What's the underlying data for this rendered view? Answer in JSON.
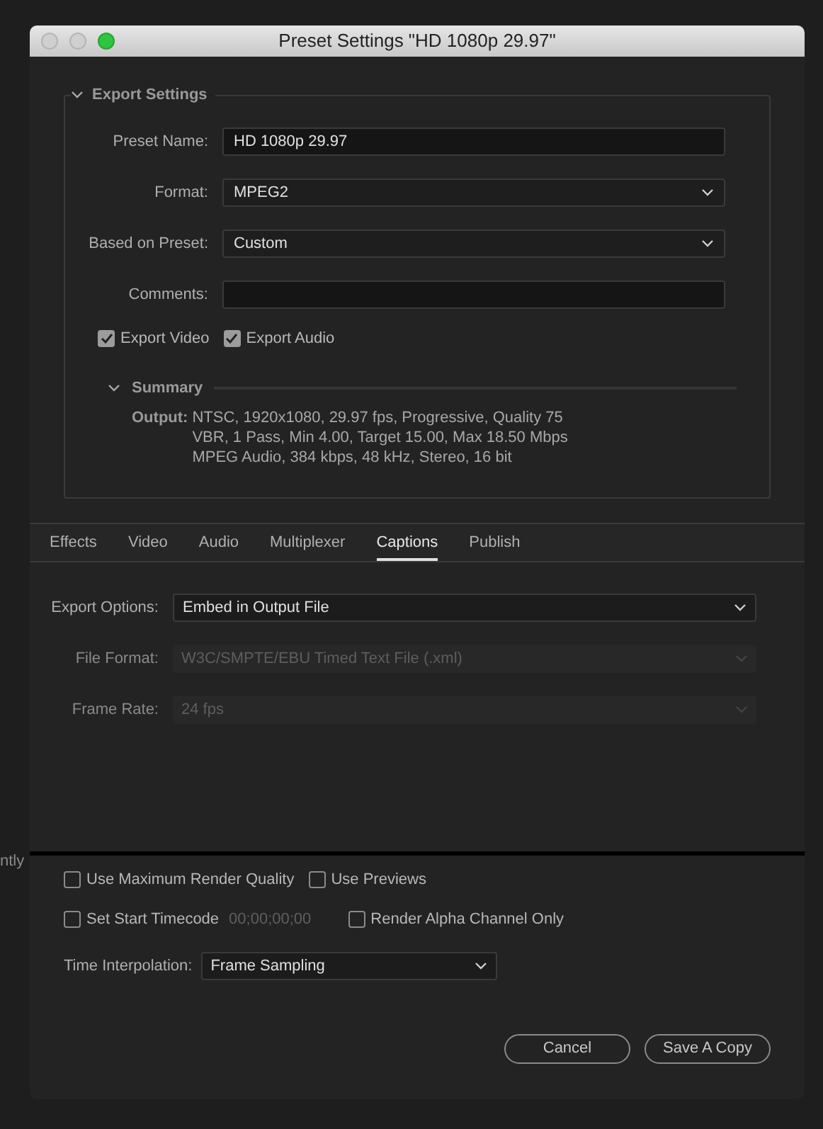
{
  "background_text": "ntly",
  "window": {
    "title": "Preset Settings \"HD 1080p 29.97\""
  },
  "export_settings": {
    "title": "Export Settings",
    "expanded": true,
    "fields": [
      {
        "kind": "text",
        "label": "Preset Name:",
        "value": "HD 1080p 29.97"
      },
      {
        "kind": "dropdown",
        "label": "Format:",
        "value": "MPEG2"
      },
      {
        "kind": "dropdown",
        "label": "Based on Preset:",
        "value": "Custom"
      },
      {
        "kind": "text",
        "label": "Comments:"
      }
    ],
    "checkboxes": [
      {
        "label": "Export Video",
        "checked": true
      },
      {
        "label": "Export Audio",
        "checked": true
      }
    ],
    "summary": {
      "title": "Summary",
      "expanded": true,
      "output_label": "Output:",
      "lines": [
        "NTSC, 1920x1080, 29.97 fps, Progressive, Quality 75",
        "VBR, 1 Pass, Min 4.00, Target 15.00, Max 18.50 Mbps",
        "MPEG Audio, 384 kbps, 48 kHz, Stereo, 16 bit"
      ]
    }
  },
  "tabs": [
    {
      "label": "Effects",
      "selected": false
    },
    {
      "label": "Video",
      "selected": false
    },
    {
      "label": "Audio",
      "selected": false
    },
    {
      "label": "Multiplexer",
      "selected": false
    },
    {
      "label": "Captions",
      "selected": true
    },
    {
      "label": "Publish",
      "selected": false
    }
  ],
  "captions": [
    {
      "label": "Export Options:",
      "value": "Embed in Output File",
      "disabled": false
    },
    {
      "label": "File Format:",
      "value": "W3C/SMPTE/EBU Timed Text File (.xml)",
      "disabled": true
    },
    {
      "label": "Frame Rate:",
      "value": "24 fps",
      "disabled": true
    }
  ],
  "options": {
    "use_max_render_quality": {
      "label": "Use Maximum Render Quality",
      "checked": false
    },
    "use_previews": {
      "label": "Use Previews",
      "checked": false
    },
    "set_start_timecode": {
      "label": "Set Start Timecode",
      "checked": false,
      "timecode": "00;00;00;00"
    },
    "render_alpha_only": {
      "label": "Render Alpha Channel Only",
      "checked": false
    },
    "time_interpolation": {
      "label": "Time Interpolation:",
      "value": "Frame Sampling"
    }
  },
  "buttons": [
    {
      "label": "Cancel"
    },
    {
      "label": "Save A Copy"
    }
  ]
}
